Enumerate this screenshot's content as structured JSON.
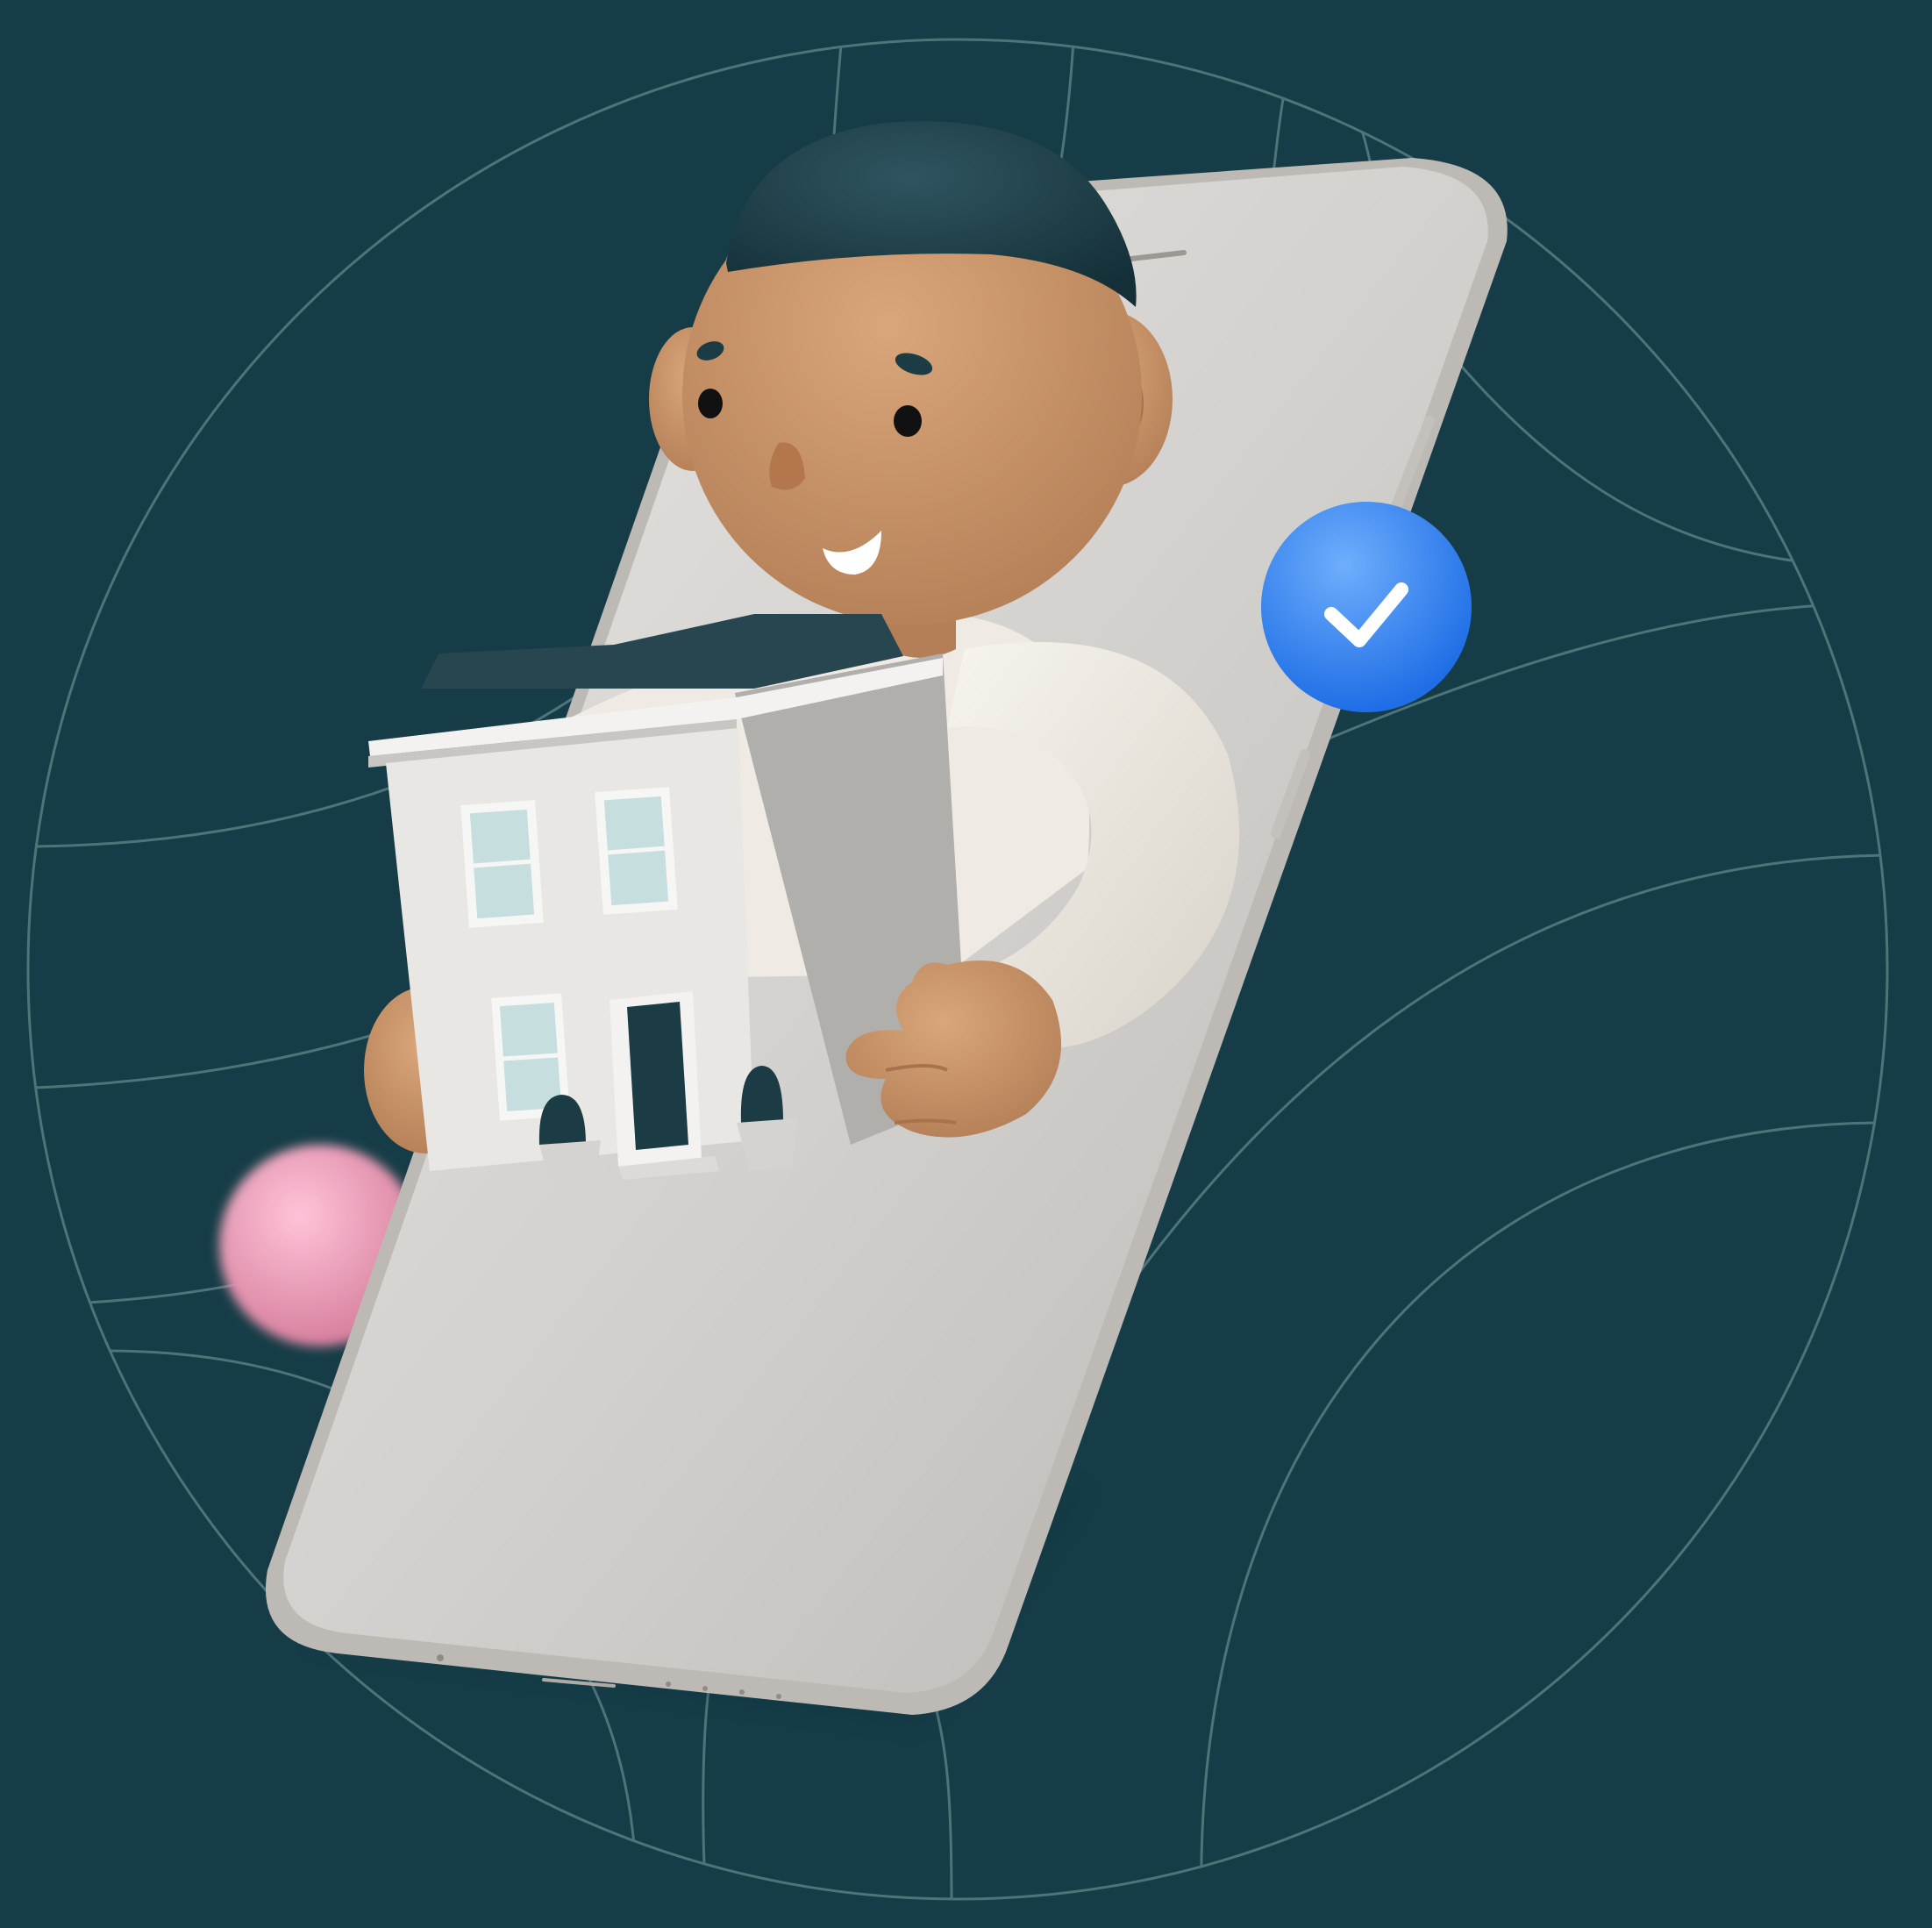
{
  "illustration": {
    "subject": "person-holding-house-emerging-from-phone",
    "icons": [
      "checkmark-badge-icon",
      "pink-sphere",
      "globe-lines"
    ]
  },
  "colors": {
    "background": "#163d47",
    "globe_lines": "#4d7479",
    "phone_body": "#d9d7d4",
    "phone_edge": "#bfbcb8",
    "skin": "#c99468",
    "hair": "#1c3c45",
    "shirt": "#efebe4",
    "house_wall": "#e8e7e4",
    "house_roof": "#274650",
    "window_glass": "#c6dede",
    "badge_blue": "#3d8ff5",
    "pink_sphere": "#e8a0bc"
  }
}
